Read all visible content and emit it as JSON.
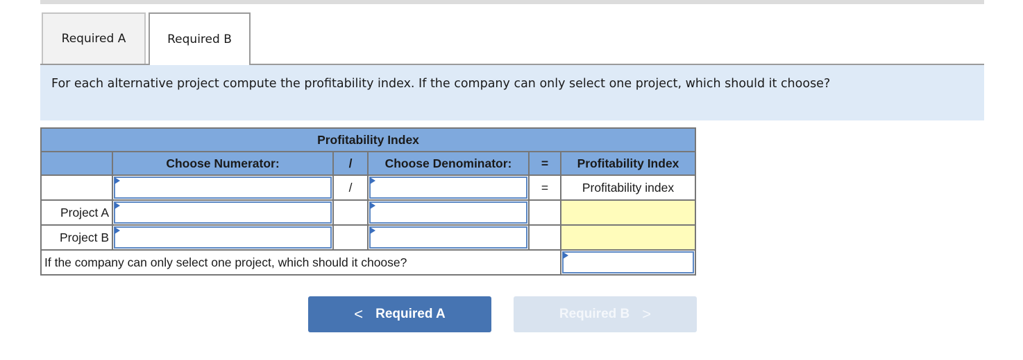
{
  "tabs": [
    {
      "label": "Required A",
      "active": false
    },
    {
      "label": "Required B",
      "active": true
    }
  ],
  "prompt": "For each alternative project compute the profitability index. If the company can only select one project, which should it choose?",
  "table": {
    "title": "Profitability Index",
    "headers": {
      "numerator": "Choose Numerator:",
      "slash": "/",
      "denominator": "Choose Denominator:",
      "equals": "=",
      "result": "Profitability Index"
    },
    "formula_row": {
      "label": "",
      "numerator_value": "",
      "slash": "/",
      "denominator_value": "",
      "equals": "=",
      "result": "Profitability index"
    },
    "rows": [
      {
        "label": "Project A",
        "numerator_value": "",
        "denominator_value": "",
        "result": ""
      },
      {
        "label": "Project B",
        "numerator_value": "",
        "denominator_value": "",
        "result": ""
      }
    ],
    "question": "If the company can only select one project, which should it choose?",
    "answer_value": ""
  },
  "nav": {
    "prev_label": "Required A",
    "prev_chevron": "<",
    "next_label": "Required B",
    "next_chevron": ">"
  },
  "colors": {
    "header_blue": "#7fa9dd",
    "prompt_bg": "#deeaf7",
    "result_yellow": "#fffcbb",
    "button_blue": "#4674b2",
    "button_disabled": "#d9e3ef"
  }
}
